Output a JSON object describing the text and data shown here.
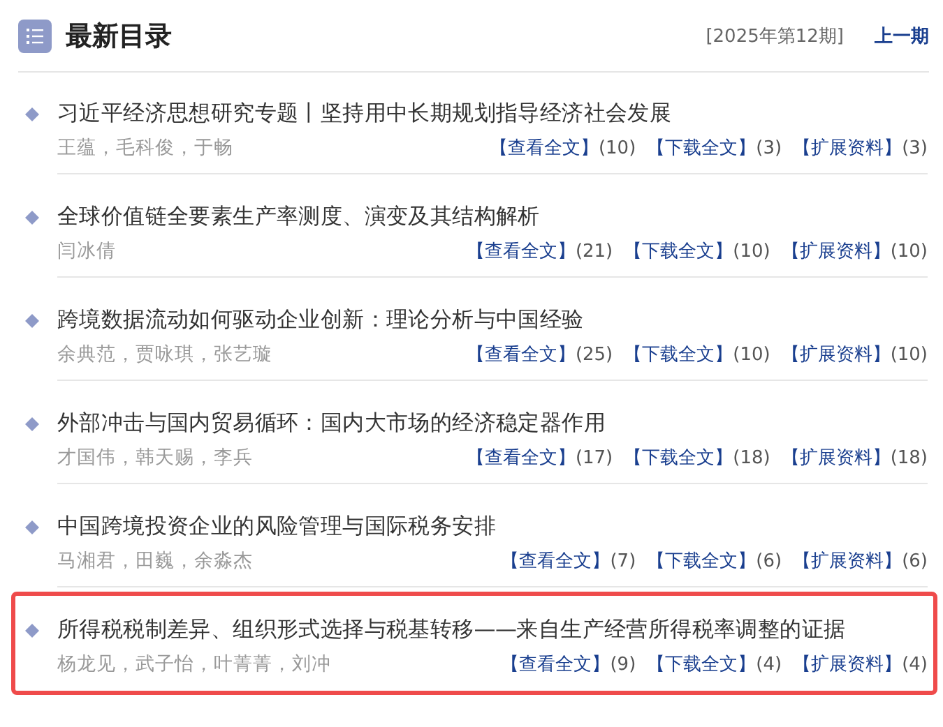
{
  "header": {
    "title": "最新目录",
    "issue": "[2025年第12期]",
    "prev_link": "上一期"
  },
  "articles": [
    {
      "title": "习近平经济思想研究专题丨坚持用中长期规划指导经济社会发展",
      "authors": "王蕴，毛科俊，于畅",
      "highlighted": false,
      "links": [
        {
          "label": "【查看全文】",
          "count": "(10)"
        },
        {
          "label": "【下载全文】",
          "count": "(3)"
        },
        {
          "label": "【扩展资料】",
          "count": "(3)"
        }
      ]
    },
    {
      "title": "全球价值链全要素生产率测度、演变及其结构解析",
      "authors": "闫冰倩",
      "highlighted": false,
      "links": [
        {
          "label": "【查看全文】",
          "count": "(21)"
        },
        {
          "label": "【下载全文】",
          "count": "(10)"
        },
        {
          "label": "【扩展资料】",
          "count": "(10)"
        }
      ]
    },
    {
      "title": "跨境数据流动如何驱动企业创新：理论分析与中国经验",
      "authors": "余典范，贾咏琪，张艺璇",
      "highlighted": false,
      "links": [
        {
          "label": "【查看全文】",
          "count": "(25)"
        },
        {
          "label": "【下载全文】",
          "count": "(10)"
        },
        {
          "label": "【扩展资料】",
          "count": "(10)"
        }
      ]
    },
    {
      "title": "外部冲击与国内贸易循环：国内大市场的经济稳定器作用",
      "authors": "才国伟，韩天赐，李兵",
      "highlighted": false,
      "links": [
        {
          "label": "【查看全文】",
          "count": "(17)"
        },
        {
          "label": "【下载全文】",
          "count": "(18)"
        },
        {
          "label": "【扩展资料】",
          "count": "(18)"
        }
      ]
    },
    {
      "title": "中国跨境投资企业的风险管理与国际税务安排",
      "authors": "马湘君，田巍，余淼杰",
      "highlighted": false,
      "links": [
        {
          "label": "【查看全文】",
          "count": "(7)"
        },
        {
          "label": "【下载全文】",
          "count": "(6)"
        },
        {
          "label": "【扩展资料】",
          "count": "(6)"
        }
      ]
    },
    {
      "title": "所得税税制差异、组织形式选择与税基转移——来自生产经营所得税率调整的证据",
      "authors": "杨龙见，武子怡，叶菁菁，刘冲",
      "highlighted": true,
      "links": [
        {
          "label": "【查看全文】",
          "count": "(9)"
        },
        {
          "label": "【下载全文】",
          "count": "(4)"
        },
        {
          "label": "【扩展资料】",
          "count": "(4)"
        }
      ]
    }
  ]
}
